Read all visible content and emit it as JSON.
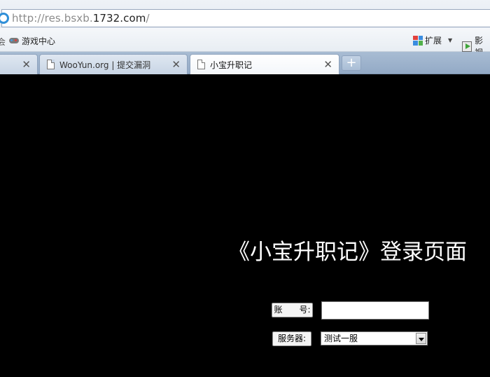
{
  "browser": {
    "address_bar": {
      "url_prefix": "http://res.bsxb.",
      "url_host": "1732.com",
      "url_suffix": "/"
    },
    "bookmarks_bar": {
      "favorites_glyph": "会",
      "items": [
        {
          "label": "游戏中心",
          "icon": "gamepad-icon"
        }
      ],
      "right_items": [
        {
          "label": "扩展",
          "icon": "grid-icon"
        },
        {
          "label": "影视",
          "icon": "video-icon"
        }
      ]
    },
    "tabs": [
      {
        "label": "",
        "active": false
      },
      {
        "label": "WooYun.org | 提交漏洞",
        "active": false
      },
      {
        "label": "小宝升职记",
        "active": true
      }
    ],
    "new_tab_label": "+"
  },
  "page": {
    "title": "《小宝升职记》登录页面",
    "account_label": "账　　号:",
    "account_value": "",
    "server_label": "服务器:",
    "server_selected": "测试一服"
  },
  "colors": {
    "page_background": "#000000",
    "title_color": "#ffffff",
    "tab_strip": "#a8bcd3"
  }
}
